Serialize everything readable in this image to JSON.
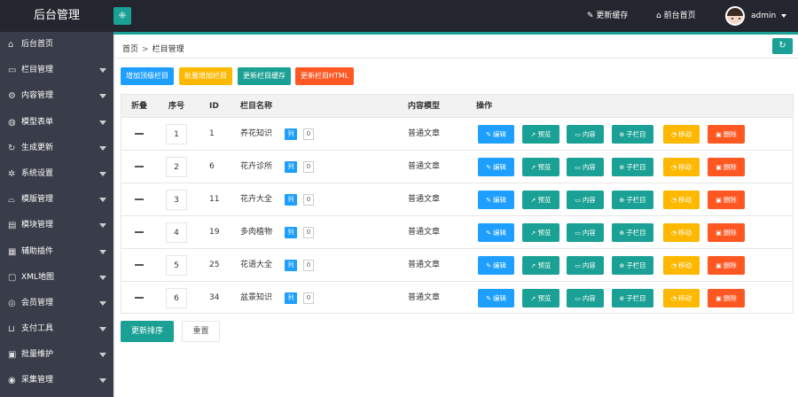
{
  "app": {
    "title": "后台管理"
  },
  "topbar": {
    "refresh_cache": "更新缓存",
    "front_home": "前台首页",
    "user": "admin"
  },
  "sidebar": {
    "items": [
      {
        "label": "后台首页",
        "icon": "home-icon",
        "glyph": "⌂",
        "expandable": false
      },
      {
        "label": "栏目管理",
        "icon": "column-icon",
        "glyph": "▭",
        "expandable": true
      },
      {
        "label": "内容管理",
        "icon": "content-icon",
        "glyph": "⚙",
        "expandable": true
      },
      {
        "label": "模型表单",
        "icon": "globe-icon",
        "glyph": "◍",
        "expandable": true
      },
      {
        "label": "生成更新",
        "icon": "refresh-icon",
        "glyph": "↻",
        "expandable": true
      },
      {
        "label": "系统设置",
        "icon": "gear-icon",
        "glyph": "✲",
        "expandable": true
      },
      {
        "label": "模版管理",
        "icon": "template-icon",
        "glyph": "⌓",
        "expandable": true
      },
      {
        "label": "模块管理",
        "icon": "module-icon",
        "glyph": "▤",
        "expandable": true
      },
      {
        "label": "辅助插件",
        "icon": "plugin-icon",
        "glyph": "▦",
        "expandable": true
      },
      {
        "label": "XML地图",
        "icon": "map-icon",
        "glyph": "▢",
        "expandable": true
      },
      {
        "label": "会员管理",
        "icon": "user-icon",
        "glyph": "◎",
        "expandable": true
      },
      {
        "label": "支付工具",
        "icon": "cart-icon",
        "glyph": "⊔",
        "expandable": true
      },
      {
        "label": "批量维护",
        "icon": "batch-icon",
        "glyph": "▣",
        "expandable": true
      },
      {
        "label": "采集管理",
        "icon": "collect-icon",
        "glyph": "◉",
        "expandable": true
      }
    ]
  },
  "breadcrumb": {
    "home": "首页",
    "sep": ">",
    "current": "栏目管理"
  },
  "toolbar": {
    "add_top": "增加顶级栏目",
    "batch_add": "批量增加栏目",
    "update_cache": "更新栏目缓存",
    "update_html": "更新栏目HTML"
  },
  "table": {
    "headers": {
      "fold": "折叠",
      "sort": "序号",
      "id": "ID",
      "name": "栏目名称",
      "model": "内容模型",
      "action": "操作"
    },
    "list_badge": "列",
    "rows": [
      {
        "sort": "1",
        "id": "1",
        "name": "养花知识",
        "count": "0",
        "model": "普通文章"
      },
      {
        "sort": "2",
        "id": "6",
        "name": "花卉诊所",
        "count": "0",
        "model": "普通文章"
      },
      {
        "sort": "3",
        "id": "11",
        "name": "花卉大全",
        "count": "0",
        "model": "普通文章"
      },
      {
        "sort": "4",
        "id": "19",
        "name": "多肉植物",
        "count": "0",
        "model": "普通文章"
      },
      {
        "sort": "5",
        "id": "25",
        "name": "花语大全",
        "count": "0",
        "model": "普通文章"
      },
      {
        "sort": "6",
        "id": "34",
        "name": "盆景知识",
        "count": "0",
        "model": "普通文章"
      }
    ],
    "actions": {
      "edit": "编辑",
      "preview": "预览",
      "content": "内容",
      "sub": "子栏目",
      "move": "移动",
      "delete": "删除"
    }
  },
  "footer": {
    "update_sort": "更新排序",
    "reset": "重置"
  },
  "colors": {
    "teal": "#1aa094",
    "blue": "#1e9fff",
    "orange": "#ffb800",
    "red": "#ff5722",
    "dark": "#23262e",
    "sidebar": "#393d49"
  }
}
